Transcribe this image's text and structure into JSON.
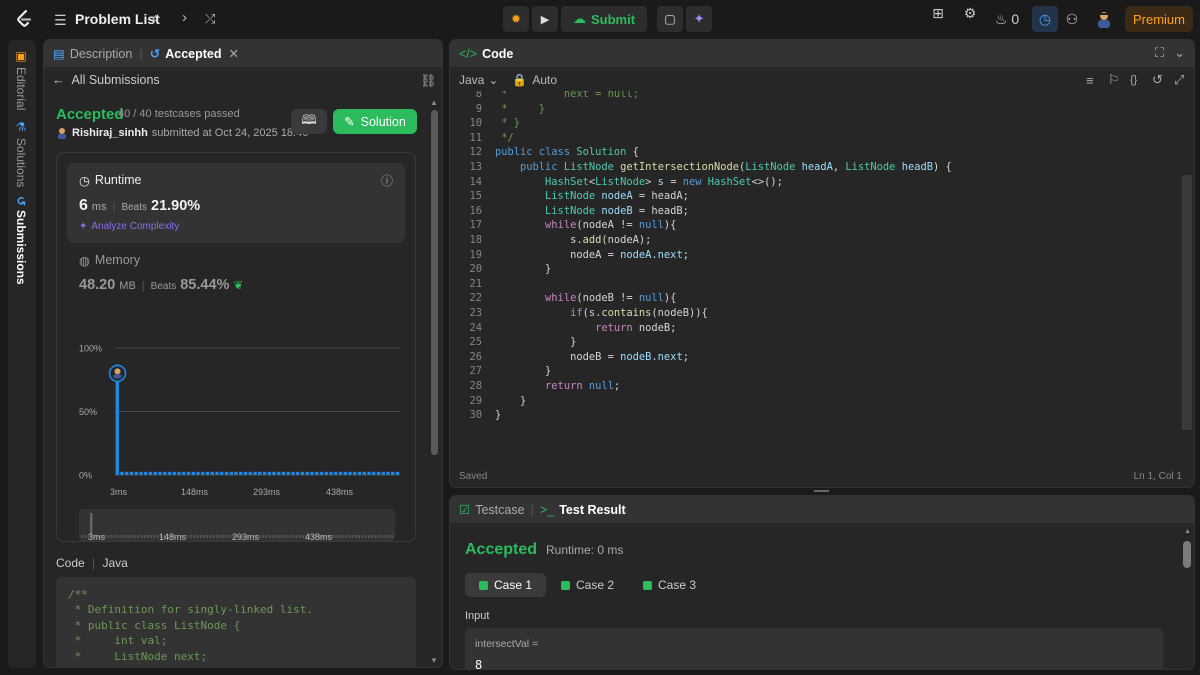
{
  "topbar": {
    "title": "Problem List",
    "submit_label": "Submit",
    "streak_count": "0",
    "premium_label": "Premium"
  },
  "sidebar": {
    "tabs": [
      "Editorial",
      "Solutions",
      "Submissions"
    ]
  },
  "left": {
    "tabs": {
      "description": "Description",
      "accepted": "Accepted"
    },
    "back_label": "All Submissions",
    "status": "Accepted",
    "testcases": "40 / 40 testcases passed",
    "user": "Rishiraj_sinhh",
    "submitted_text": "submitted at Oct 24, 2025 18:46",
    "solution_label": "Solution",
    "runtime": {
      "label": "Runtime",
      "value": "6",
      "unit": "ms",
      "beats_label": "Beats",
      "beats": "21.90%",
      "analyze": "Analyze Complexity"
    },
    "memory": {
      "label": "Memory",
      "value": "48.20",
      "unit": "MB",
      "beats_label": "Beats",
      "beats": "85.44%"
    },
    "code_label": "Code",
    "code_lang": "Java",
    "code_preview": "/**\n * Definition for singly-linked list.\n * public class ListNode {\n *     int val;\n *     ListNode next;"
  },
  "chart_data": {
    "type": "bar",
    "ylabel_ticks": [
      "100%",
      "50%",
      "0%"
    ],
    "x_ticks": [
      "3ms",
      "148ms",
      "293ms",
      "438ms"
    ],
    "ylim": [
      0,
      100
    ],
    "highlight_value": 6,
    "highlight_percent": 80,
    "bars_first": 87,
    "bar_count": 60,
    "bar_rest_level": 2.5,
    "brush_ticks": [
      "3ms",
      "148ms",
      "293ms",
      "438ms"
    ]
  },
  "code": {
    "title": "Code",
    "language": "Java",
    "mode": "Auto",
    "status": "Saved",
    "cursor": "Ln 1, Col 1",
    "lines": [
      {
        "n": "8",
        "html": "<span class=\"c\"> *         next = null;</span>"
      },
      {
        "n": "9",
        "html": "<span class=\"c\"> *     }</span>"
      },
      {
        "n": "10",
        "html": "<span class=\"c\"> * }</span>"
      },
      {
        "n": "11",
        "html": "<span class=\"c\"> */</span>"
      },
      {
        "n": "12",
        "html": "<span class=\"kw\">public</span> <span class=\"kw\">class</span> <span class=\"t\">Solution</span> {"
      },
      {
        "n": "13",
        "html": "    <span class=\"kw\">public</span> <span class=\"t\">ListNode</span> <span class=\"f\">getIntersectionNode</span>(<span class=\"t\">ListNode</span> <span class=\"v\">headA</span>, <span class=\"t\">ListNode</span> <span class=\"v\">headB</span>) {"
      },
      {
        "n": "14",
        "html": "        <span class=\"t\">HashSet</span>&lt;<span class=\"t\">ListNode</span>&gt; <span class=\"v\">s</span> = <span class=\"kw\">new</span> <span class=\"t\">HashSet</span>&lt;&gt;();"
      },
      {
        "n": "15",
        "html": "        <span class=\"t\">ListNode</span> <span class=\"v\">nodeA</span> = headA;"
      },
      {
        "n": "16",
        "html": "        <span class=\"t\">ListNode</span> <span class=\"v\">nodeB</span> = headB;"
      },
      {
        "n": "17",
        "html": "        <span class=\"k\">while</span>(nodeA != <span class=\"kw\">null</span>){"
      },
      {
        "n": "18",
        "html": "            s.<span class=\"f\">add</span>(nodeA);"
      },
      {
        "n": "19",
        "html": "            nodeA = <span class=\"v\">nodeA</span>.<span class=\"v\">next</span>;"
      },
      {
        "n": "20",
        "html": "        }"
      },
      {
        "n": "21",
        "html": ""
      },
      {
        "n": "22",
        "html": "        <span class=\"k\">while</span>(nodeB != <span class=\"kw\">null</span>){"
      },
      {
        "n": "23",
        "html": "            <span class=\"k\">if</span>(s.<span class=\"f\">contains</span>(nodeB)){"
      },
      {
        "n": "24",
        "html": "                <span class=\"k\">return</span> nodeB;"
      },
      {
        "n": "25",
        "html": "            }"
      },
      {
        "n": "26",
        "html": "            nodeB = <span class=\"v\">nodeB</span>.<span class=\"v\">next</span>;"
      },
      {
        "n": "27",
        "html": "        }"
      },
      {
        "n": "28",
        "html": "        <span class=\"k\">return</span> <span class=\"kw\">null</span>;"
      },
      {
        "n": "29",
        "html": "    }"
      },
      {
        "n": "30",
        "html": "}"
      }
    ]
  },
  "test": {
    "tab_testcase": "Testcase",
    "tab_result": "Test Result",
    "status": "Accepted",
    "runtime": "Runtime: 0 ms",
    "cases": [
      "Case 1",
      "Case 2",
      "Case 3"
    ],
    "input_label": "Input",
    "var_label": "intersectVal =",
    "var_value": "8"
  },
  "colors": {
    "accent": "#2cbb5d",
    "premium": "#ffa116",
    "chart_bar": "#1e88e5"
  }
}
